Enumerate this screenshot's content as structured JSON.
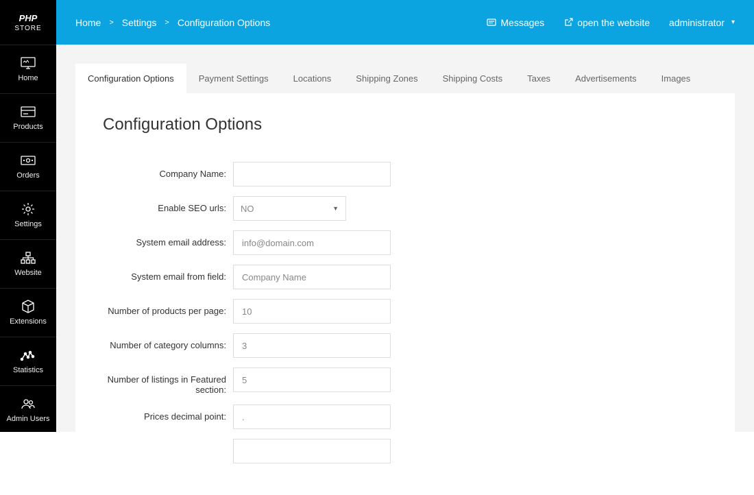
{
  "logo": {
    "top": "PHP",
    "bottom": "STORE"
  },
  "sidebar": {
    "items": [
      {
        "label": "Home"
      },
      {
        "label": "Products"
      },
      {
        "label": "Orders"
      },
      {
        "label": "Settings"
      },
      {
        "label": "Website"
      },
      {
        "label": "Extensions"
      },
      {
        "label": "Statistics"
      },
      {
        "label": "Admin Users"
      }
    ]
  },
  "breadcrumb": {
    "items": [
      "Home",
      "Settings",
      "Configuration Options"
    ],
    "sep": ">"
  },
  "header": {
    "messages": "Messages",
    "open": "open the website",
    "user": "administrator"
  },
  "tabs": [
    "Configuration Options",
    "Payment Settings",
    "Locations",
    "Shipping Zones",
    "Shipping Costs",
    "Taxes",
    "Advertisements",
    "Images"
  ],
  "panel": {
    "title": "Configuration Options"
  },
  "form": {
    "company_name": {
      "label": "Company Name:",
      "value": ""
    },
    "seo": {
      "label": "Enable SEO urls:",
      "value": "NO"
    },
    "email_addr": {
      "label": "System email address:",
      "value": "info@domain.com"
    },
    "email_from": {
      "label": "System email from field:",
      "value": "Company Name"
    },
    "per_page": {
      "label": "Number of products per page:",
      "value": "10"
    },
    "cat_cols": {
      "label": "Number of category columns:",
      "value": "3"
    },
    "featured": {
      "label": "Number of listings in Featured section:",
      "value": "5"
    },
    "decimal": {
      "label": "Prices decimal point:",
      "value": "."
    }
  }
}
